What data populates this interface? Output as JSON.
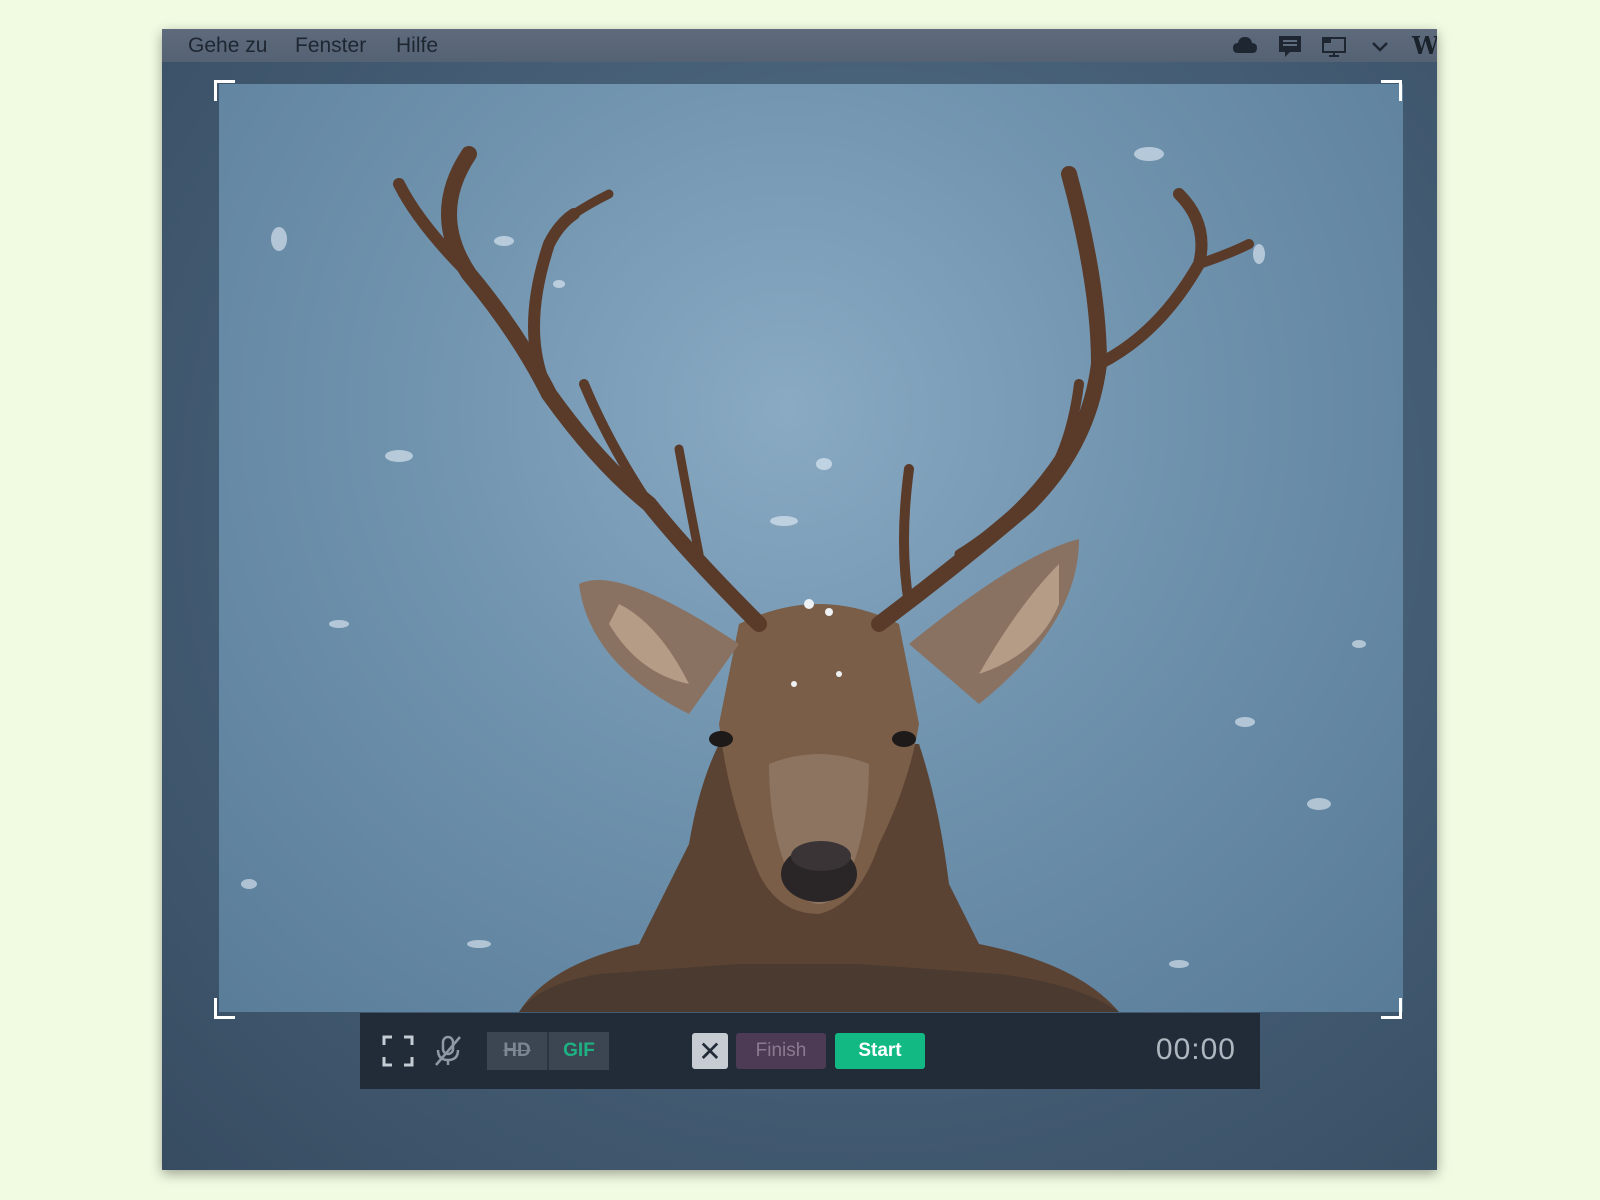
{
  "menubar": {
    "items": [
      "Gehe zu",
      "Fenster",
      "Hilfe"
    ],
    "tray_icons": [
      "cloud-icon",
      "message-icon",
      "display-icon",
      "chevron-down-icon"
    ],
    "tray_letter": "W"
  },
  "capture": {
    "subject": "deer-photo"
  },
  "toolbar": {
    "fullscreen_icon": "fullscreen-icon",
    "mic_icon": "microphone-muted-icon",
    "hd_label": "HD",
    "gif_label": "GIF",
    "close_label": "✕",
    "finish_label": "Finish",
    "start_label": "Start",
    "timer": "00:00"
  },
  "colors": {
    "start_green": "#12b983",
    "finish_purple": "#4d3b55",
    "gif_green": "#1eb283",
    "toolbar_bg": "#222c38"
  }
}
